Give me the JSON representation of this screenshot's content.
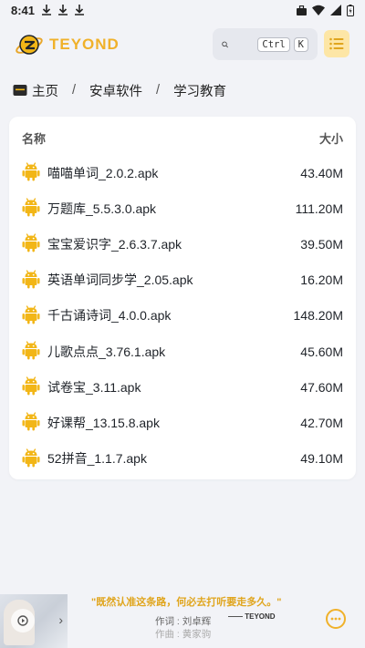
{
  "status": {
    "time": "8:41"
  },
  "header": {
    "brand": "TEYOND",
    "shortcut_key1": "Ctrl",
    "shortcut_key2": "K"
  },
  "breadcrumb": {
    "home": "主页",
    "category": "安卓软件",
    "current": "学习教育"
  },
  "table": {
    "col_name": "名称",
    "col_size": "大小",
    "rows": [
      {
        "name": "喵喵单词_2.0.2.apk",
        "size": "43.40M"
      },
      {
        "name": "万题库_5.5.3.0.apk",
        "size": "111.20M"
      },
      {
        "name": "宝宝爱识字_2.6.3.7.apk",
        "size": "39.50M"
      },
      {
        "name": "英语单词同步学_2.05.apk",
        "size": "16.20M"
      },
      {
        "name": "千古诵诗词_4.0.0.apk",
        "size": "148.20M"
      },
      {
        "name": "儿歌点点_3.76.1.apk",
        "size": "45.60M"
      },
      {
        "name": "试卷宝_3.11.apk",
        "size": "47.60M"
      },
      {
        "name": "好课帮_13.15.8.apk",
        "size": "42.70M"
      },
      {
        "name": "52拼音_1.1.7.apk",
        "size": "49.10M"
      }
    ]
  },
  "player": {
    "quote": "\"既然认准这条路，何必去打听要走多久。\"",
    "lyricist": "作词 : 刘卓辉",
    "composer": "作曲 : 黄家驹",
    "signature": "—— TEYOND"
  },
  "colors": {
    "accent": "#f0b12a",
    "android": "#f2b617",
    "background": "#f2f3f7"
  }
}
